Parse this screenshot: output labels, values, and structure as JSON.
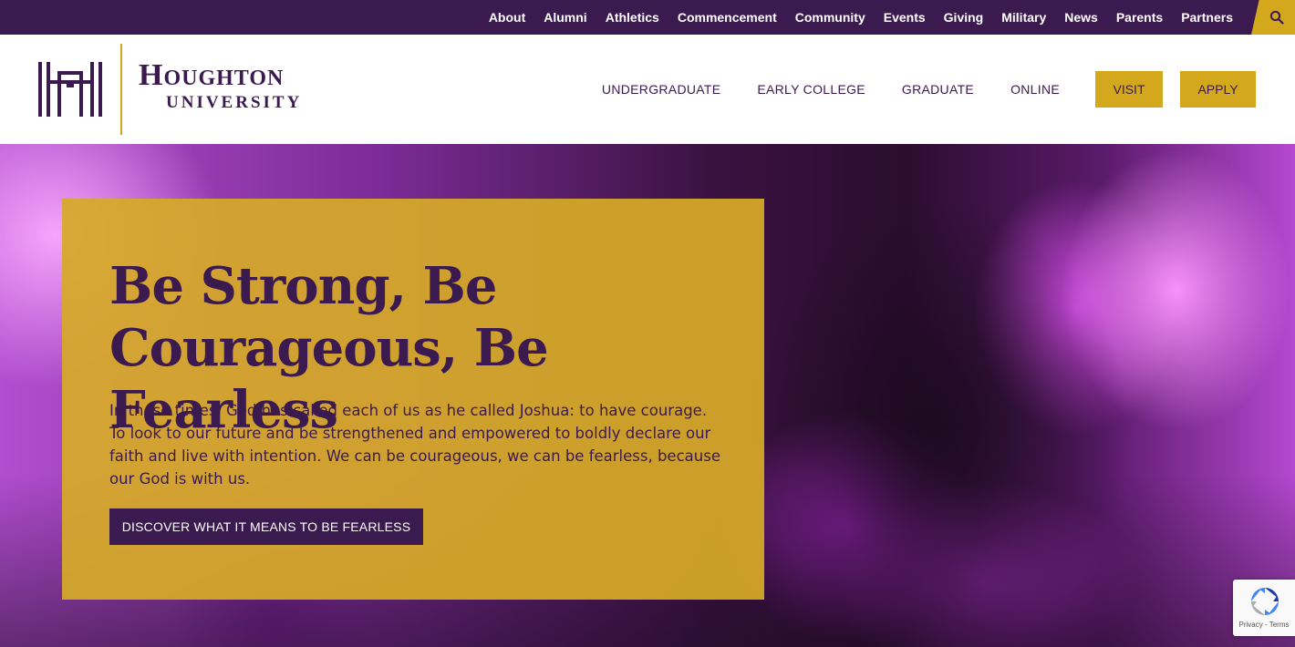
{
  "colors": {
    "brand_purple": "#3b1a4f",
    "brand_gold": "#d4a81c",
    "white": "#ffffff"
  },
  "utility_nav": {
    "items": [
      "About",
      "Alumni",
      "Athletics",
      "Commencement",
      "Community",
      "Events",
      "Giving",
      "Military",
      "News",
      "Parents",
      "Partners"
    ],
    "search_icon": "search-icon"
  },
  "logo": {
    "word_line1": "Houghton",
    "word_line2": "UNIVERSITY",
    "mark_icon": "houghton-h-mark-icon"
  },
  "main_nav": {
    "items": [
      "UNDERGRADUATE",
      "EARLY COLLEGE",
      "GRADUATE",
      "ONLINE"
    ],
    "visit_label": "VISIT",
    "apply_label": "APPLY"
  },
  "hero": {
    "title": "Be Strong, Be Courageous, Be Fearless",
    "body": "In these times, God has called each of us as he called Joshua: to have courage. To look to our future and be strengthened and empowered to boldly declare our faith and live with intention. We can be courageous, we can be fearless, because our God is with us.",
    "button_label": "DISCOVER WHAT IT MEANS TO BE FEARLESS"
  },
  "recaptcha": {
    "links": "Privacy - Terms",
    "icon": "recaptcha-icon"
  }
}
